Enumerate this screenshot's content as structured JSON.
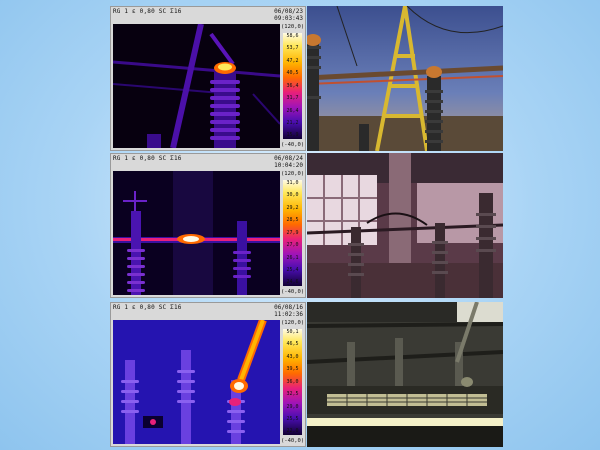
{
  "panels": [
    {
      "header": "RG 1 ε 0,80 SC Σ16",
      "date": "06/08/23",
      "time": "09:03:43",
      "scale_max": "(120,0)",
      "scale_min": "(-40,0)",
      "ticks": [
        "58,6",
        "53,7",
        "47,2",
        "40,5",
        "36,4",
        "31,7",
        "26,4",
        "21,2",
        "15,9"
      ]
    },
    {
      "header": "RG 1 ε 0,80 SC Σ16",
      "date": "06/08/24",
      "time": "10:04:20",
      "scale_max": "(120,0)",
      "scale_min": "(-40,0)",
      "ticks": [
        "31,0",
        "30,0",
        "29,2",
        "28,5",
        "27,9",
        "27,0",
        "26,1",
        "25,4",
        "24,6"
      ]
    },
    {
      "header": "RG 1 ε 0,80 SC Σ16",
      "date": "06/08/16",
      "time": "11:02:36",
      "scale_max": "(120,0)",
      "scale_min": "(-40,0)",
      "ticks": [
        "50,1",
        "46,5",
        "43,0",
        "39,5",
        "36,0",
        "32,5",
        "29,0",
        "25,5",
        "22,0"
      ]
    }
  ],
  "colors": {
    "background": "#a9d4f5",
    "palette_hot": "#ffe85a",
    "palette_cold": "#110033"
  }
}
